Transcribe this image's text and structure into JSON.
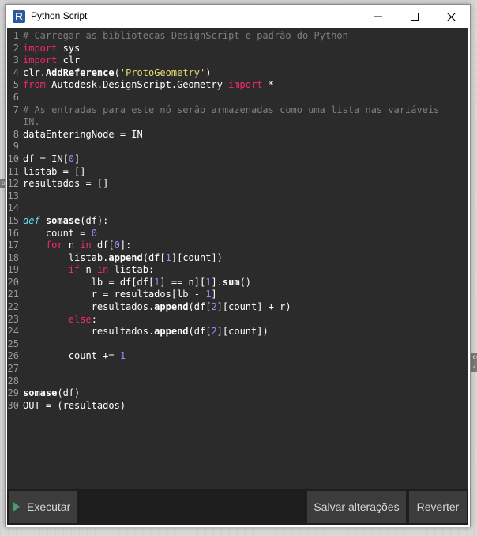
{
  "window": {
    "title": "Python Script",
    "app_icon_letter": "R"
  },
  "background": {
    "node_snippets": [
      "a",
      "co",
      "2:"
    ]
  },
  "editor": {
    "lines": [
      {
        "n": "1",
        "tokens": [
          {
            "t": "# Carregar as bibliotecas DesignScript e padrão do Python",
            "c": "comment"
          }
        ]
      },
      {
        "n": "2",
        "tokens": [
          {
            "t": "import",
            "c": "kw"
          },
          {
            "t": " sys",
            "c": ""
          }
        ]
      },
      {
        "n": "3",
        "tokens": [
          {
            "t": "import",
            "c": "kw"
          },
          {
            "t": " clr",
            "c": ""
          }
        ]
      },
      {
        "n": "4",
        "tokens": [
          {
            "t": "clr.",
            "c": ""
          },
          {
            "t": "AddReference",
            "c": "fn"
          },
          {
            "t": "(",
            "c": ""
          },
          {
            "t": "'ProtoGeometry'",
            "c": "str"
          },
          {
            "t": ")",
            "c": ""
          }
        ]
      },
      {
        "n": "5",
        "tokens": [
          {
            "t": "from",
            "c": "kw"
          },
          {
            "t": " Autodesk.DesignScript.Geometry ",
            "c": ""
          },
          {
            "t": "import",
            "c": "kw"
          },
          {
            "t": " *",
            "c": ""
          }
        ]
      },
      {
        "n": "6",
        "tokens": []
      },
      {
        "n": "7",
        "tokens": [
          {
            "t": "# As entradas para este nó serão armazenadas como uma lista nas variáveis",
            "c": "comment"
          }
        ]
      },
      {
        "n": "",
        "tokens": [
          {
            "t": "IN.",
            "c": "comment"
          }
        ]
      },
      {
        "n": "8",
        "tokens": [
          {
            "t": "dataEnteringNode = IN",
            "c": ""
          }
        ]
      },
      {
        "n": "9",
        "tokens": []
      },
      {
        "n": "10",
        "tokens": [
          {
            "t": "df = IN[",
            "c": ""
          },
          {
            "t": "0",
            "c": "num"
          },
          {
            "t": "]",
            "c": ""
          }
        ]
      },
      {
        "n": "11",
        "tokens": [
          {
            "t": "listab = []",
            "c": ""
          }
        ]
      },
      {
        "n": "12",
        "tokens": [
          {
            "t": "resultados = []",
            "c": ""
          }
        ]
      },
      {
        "n": "13",
        "tokens": []
      },
      {
        "n": "14",
        "tokens": []
      },
      {
        "n": "15",
        "tokens": [
          {
            "t": "def",
            "c": "def"
          },
          {
            "t": " ",
            "c": ""
          },
          {
            "t": "somase",
            "c": "fn"
          },
          {
            "t": "(df):",
            "c": ""
          }
        ]
      },
      {
        "n": "16",
        "tokens": [
          {
            "t": "    count = ",
            "c": ""
          },
          {
            "t": "0",
            "c": "num"
          }
        ]
      },
      {
        "n": "17",
        "tokens": [
          {
            "t": "    ",
            "c": ""
          },
          {
            "t": "for",
            "c": "kw"
          },
          {
            "t": " n ",
            "c": ""
          },
          {
            "t": "in",
            "c": "kw"
          },
          {
            "t": " df[",
            "c": ""
          },
          {
            "t": "0",
            "c": "num"
          },
          {
            "t": "]:",
            "c": ""
          }
        ]
      },
      {
        "n": "18",
        "tokens": [
          {
            "t": "        listab.",
            "c": ""
          },
          {
            "t": "append",
            "c": "fn"
          },
          {
            "t": "(df[",
            "c": ""
          },
          {
            "t": "1",
            "c": "num"
          },
          {
            "t": "][count])",
            "c": ""
          }
        ]
      },
      {
        "n": "19",
        "tokens": [
          {
            "t": "        ",
            "c": ""
          },
          {
            "t": "if",
            "c": "kw"
          },
          {
            "t": " n ",
            "c": ""
          },
          {
            "t": "in",
            "c": "kw"
          },
          {
            "t": " listab:",
            "c": ""
          }
        ]
      },
      {
        "n": "20",
        "tokens": [
          {
            "t": "            lb = df[df[",
            "c": ""
          },
          {
            "t": "1",
            "c": "num"
          },
          {
            "t": "] == n][",
            "c": ""
          },
          {
            "t": "1",
            "c": "num"
          },
          {
            "t": "].",
            "c": ""
          },
          {
            "t": "sum",
            "c": "fn"
          },
          {
            "t": "()",
            "c": ""
          }
        ]
      },
      {
        "n": "21",
        "tokens": [
          {
            "t": "            r = resultados[lb - ",
            "c": ""
          },
          {
            "t": "1",
            "c": "num"
          },
          {
            "t": "]",
            "c": ""
          }
        ]
      },
      {
        "n": "22",
        "tokens": [
          {
            "t": "            resultados.",
            "c": ""
          },
          {
            "t": "append",
            "c": "fn"
          },
          {
            "t": "(df[",
            "c": ""
          },
          {
            "t": "2",
            "c": "num"
          },
          {
            "t": "][count] + r)",
            "c": ""
          }
        ]
      },
      {
        "n": "23",
        "tokens": [
          {
            "t": "        ",
            "c": ""
          },
          {
            "t": "else",
            "c": "kw"
          },
          {
            "t": ":",
            "c": ""
          }
        ]
      },
      {
        "n": "24",
        "tokens": [
          {
            "t": "            resultados.",
            "c": ""
          },
          {
            "t": "append",
            "c": "fn"
          },
          {
            "t": "(df[",
            "c": ""
          },
          {
            "t": "2",
            "c": "num"
          },
          {
            "t": "][count])",
            "c": ""
          }
        ]
      },
      {
        "n": "25",
        "tokens": []
      },
      {
        "n": "26",
        "tokens": [
          {
            "t": "        count += ",
            "c": ""
          },
          {
            "t": "1",
            "c": "num"
          }
        ]
      },
      {
        "n": "27",
        "tokens": []
      },
      {
        "n": "28",
        "tokens": []
      },
      {
        "n": "29",
        "tokens": [
          {
            "t": "somase",
            "c": "fn"
          },
          {
            "t": "(df)",
            "c": ""
          }
        ]
      },
      {
        "n": "30",
        "tokens": [
          {
            "t": "OUT = (resultados)",
            "c": ""
          }
        ]
      }
    ]
  },
  "footer": {
    "run_label": "Executar",
    "save_label": "Salvar alterações",
    "revert_label": "Reverter"
  },
  "colors": {
    "editor_bg": "#2b2b2b",
    "keyword": "#f92672",
    "def_keyword": "#66d9ef",
    "number": "#ae81ff",
    "string": "#e6db74",
    "comment": "#7e7e7e",
    "footer_bg": "#1e1e1e",
    "button_bg": "#3c3c3c"
  }
}
